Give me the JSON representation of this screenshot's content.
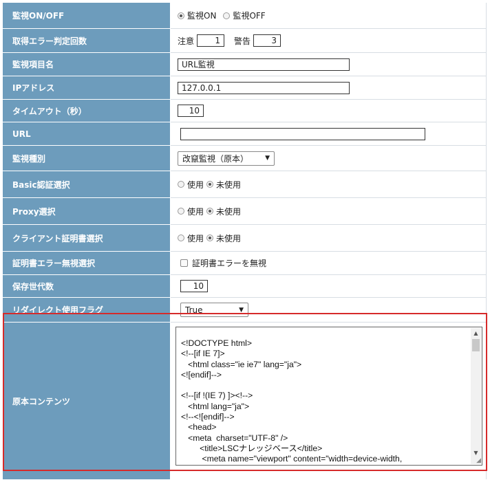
{
  "rows": {
    "monitor": {
      "label": "監視ON/OFF",
      "on": "監視ON",
      "off": "監視OFF"
    },
    "error_count": {
      "label": "取得エラー判定回数",
      "notice_label": "注意",
      "notice_value": "1",
      "warning_label": "警告",
      "warning_value": "3"
    },
    "item_name": {
      "label": "監視項目名",
      "value": "URL監視"
    },
    "ip": {
      "label": "IPアドレス",
      "value": "127.0.0.1"
    },
    "timeout": {
      "label": "タイムアウト（秒）",
      "value": "10"
    },
    "url": {
      "label": "URL",
      "value": ""
    },
    "monitor_type": {
      "label": "監視種別",
      "selected": "改竄監視（原本）"
    },
    "basic_auth": {
      "label": "Basic認証選択",
      "use": "使用",
      "unused": "未使用"
    },
    "proxy": {
      "label": "Proxy選択",
      "use": "使用",
      "unused": "未使用"
    },
    "client_cert": {
      "label": "クライアント証明書選択",
      "use": "使用",
      "unused": "未使用"
    },
    "cert_error": {
      "label": "証明書エラー無視選択",
      "checkbox_label": "証明書エラーを無視"
    },
    "generations": {
      "label": "保存世代数",
      "value": "10"
    },
    "redirect": {
      "label": "リダイレクト使用フラグ",
      "selected": "True"
    },
    "original": {
      "label": "原本コンテンツ",
      "content": "<!DOCTYPE html>\n<!--[if IE 7]>\n   <html class=\"ie ie7\" lang=\"ja\">\n<![endif]-->\n\n<!--[if !(IE 7) ]><!-->\n   <html lang=\"ja\">\n<!--<![endif]-->\n   <head>\n   <meta  charset=\"UTF-8\" />\n        <title>LSCナレッジベース</title>\n         <meta name=\"viewport\" content=\"width=device-width,"
    }
  },
  "colors": {
    "label_bg": "#6d9cbc",
    "highlight": "#d62a2a"
  }
}
